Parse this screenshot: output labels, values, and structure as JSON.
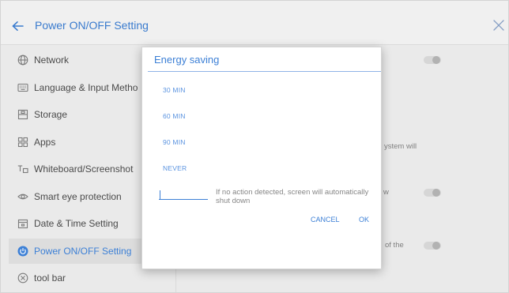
{
  "header": {
    "title": "Power ON/OFF Setting",
    "back_icon": "back-arrow-icon",
    "close_icon": "close-icon"
  },
  "sidebar": {
    "items": [
      {
        "label": "Network",
        "icon": "globe-icon",
        "selected": false
      },
      {
        "label": "Language & Input Metho",
        "icon": "keyboard-icon",
        "selected": false
      },
      {
        "label": "Storage",
        "icon": "storage-icon",
        "selected": false
      },
      {
        "label": "Apps",
        "icon": "apps-grid-icon",
        "selected": false
      },
      {
        "label": "Whiteboard/Screenshot",
        "icon": "whiteboard-icon",
        "selected": false
      },
      {
        "label": "Smart eye protection",
        "icon": "eye-icon",
        "selected": false
      },
      {
        "label": "Date & Time Setting",
        "icon": "calendar-icon",
        "selected": false
      },
      {
        "label": "Power ON/OFF Setting",
        "icon": "power-icon",
        "selected": true
      },
      {
        "label": "tool bar",
        "icon": "toolbar-icon",
        "selected": false
      }
    ]
  },
  "content": {
    "text_fragments": [
      "ystem will",
      "w",
      "of the"
    ]
  },
  "dialog": {
    "title": "Energy saving",
    "options": [
      "30 MIN",
      "60 MIN",
      "90 MIN",
      "NEVER"
    ],
    "hint": "If no action detected, screen will automatically shut down",
    "cancel_label": "CANCEL",
    "ok_label": "OK"
  },
  "colors": {
    "accent": "#3d80d6",
    "option_text": "#5a93e0",
    "text": "#4a4a4a",
    "muted_text": "#868686",
    "selected_bg": "#e6e6e6"
  }
}
